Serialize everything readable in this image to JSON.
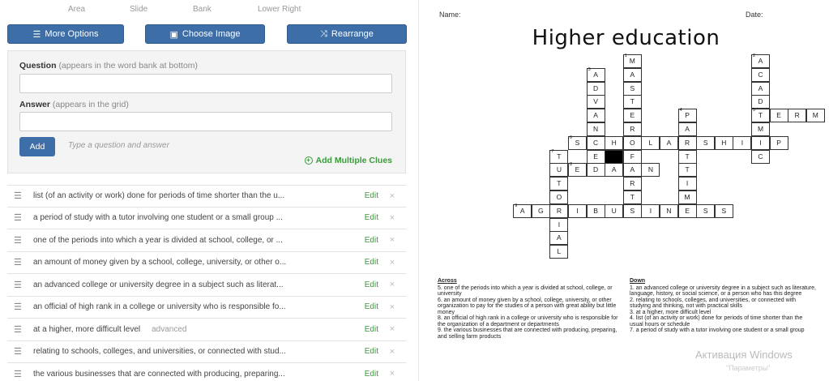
{
  "top_cut": [
    "Area",
    "Slide",
    "Bank",
    "Lower Right"
  ],
  "toolbar": {
    "more_options": "More Options",
    "choose_image": "Choose Image",
    "rearrange": "Rearrange"
  },
  "form": {
    "question_label": "Question",
    "question_hint": "(appears in the word bank at bottom)",
    "question_value": "",
    "answer_label": "Answer",
    "answer_hint": "(appears in the grid)",
    "answer_value": "",
    "add_label": "Add",
    "add_hint": "Type a question and answer",
    "add_multiple": "Add Multiple Clues"
  },
  "clues": [
    {
      "text": "list (of an activity or work) done for periods of time shorter than the u...",
      "answer": ""
    },
    {
      "text": "a period of study with a tutor involving one student or a small group ...",
      "answer": ""
    },
    {
      "text": "one of the periods into which a year is divided at school, college, or ...",
      "answer": ""
    },
    {
      "text": "an amount of money given by a school, college, university, or other o...",
      "answer": ""
    },
    {
      "text": "an advanced college or university degree in a subject such as literat...",
      "answer": ""
    },
    {
      "text": "an official of high rank in a college or university who is responsible fo...",
      "answer": ""
    },
    {
      "text": "at a higher, more difficult level",
      "answer": "advanced"
    },
    {
      "text": "relating to schools, colleges, and universities, or connected with stud...",
      "answer": ""
    },
    {
      "text": "the various businesses that are connected with producing, preparing...",
      "answer": ""
    }
  ],
  "clue_edit": "Edit",
  "clue_delete": "×",
  "puzzle": {
    "name_label": "Name:",
    "date_label": "Date:",
    "title": "Higher education",
    "across_heading": "Across",
    "down_heading": "Down",
    "across": [
      "5. one of the periods into which a year is divided at school, college, or university",
      "6. an amount of money given by a school, college, university, or other organization to pay for the studies of a person with great ability but little money",
      "8. an official of high rank in a college or university who is responsible for the organization of a department or departments",
      "9. the various businesses that are connected with producing, preparing, and selling farm products"
    ],
    "down": [
      "1. an advanced college or university degree in a subject such as literature, language, history, or social science, or a person who has this degree",
      "2. relating to schools, colleges, and universities, or connected with studying and thinking, not with practical skills",
      "3. at a higher, more difficult level",
      "4. list (of an activity or work) done for periods of time shorter than the usual hours or schedule",
      "7. a period of study with a tutor involving one student or a small group"
    ],
    "watermark": "Активация Windows",
    "watermark2": "\"Параметры\""
  },
  "grid_cells": [
    {
      "c": 8,
      "r": 0,
      "l": "M",
      "n": "1"
    },
    {
      "c": 8,
      "r": 1,
      "l": "A"
    },
    {
      "c": 8,
      "r": 2,
      "l": "S"
    },
    {
      "c": 8,
      "r": 3,
      "l": "T"
    },
    {
      "c": 8,
      "r": 4,
      "l": "E"
    },
    {
      "c": 8,
      "r": 5,
      "l": "R"
    },
    {
      "c": 8,
      "r": 6,
      "l": "O"
    },
    {
      "c": 8,
      "r": 7,
      "l": "F"
    },
    {
      "c": 8,
      "r": 8,
      "l": "A"
    },
    {
      "c": 8,
      "r": 9,
      "l": "R"
    },
    {
      "c": 8,
      "r": 10,
      "l": "T"
    },
    {
      "c": 8,
      "r": 11,
      "l": "S"
    },
    {
      "c": 15,
      "r": 0,
      "l": "A",
      "n": "2"
    },
    {
      "c": 15,
      "r": 1,
      "l": "C"
    },
    {
      "c": 15,
      "r": 2,
      "l": "A"
    },
    {
      "c": 15,
      "r": 3,
      "l": "D"
    },
    {
      "c": 15,
      "r": 4,
      "l": "E"
    },
    {
      "c": 15,
      "r": 5,
      "l": "M"
    },
    {
      "c": 15,
      "r": 6,
      "l": "I"
    },
    {
      "c": 15,
      "r": 7,
      "l": "C"
    },
    {
      "c": 6,
      "r": 1,
      "l": "A",
      "n": "3"
    },
    {
      "c": 6,
      "r": 2,
      "l": "D"
    },
    {
      "c": 6,
      "r": 3,
      "l": "V"
    },
    {
      "c": 6,
      "r": 4,
      "l": "A"
    },
    {
      "c": 6,
      "r": 5,
      "l": "N"
    },
    {
      "c": 6,
      "r": 6,
      "l": "C"
    },
    {
      "c": 6,
      "r": 7,
      "l": "E"
    },
    {
      "c": 6,
      "r": 8,
      "l": "D"
    },
    {
      "c": 11,
      "r": 4,
      "l": "P",
      "n": "4"
    },
    {
      "c": 11,
      "r": 5,
      "l": "A"
    },
    {
      "c": 11,
      "r": 6,
      "l": "R"
    },
    {
      "c": 11,
      "r": 7,
      "l": "T"
    },
    {
      "c": 11,
      "r": 8,
      "l": "T"
    },
    {
      "c": 11,
      "r": 9,
      "l": "I"
    },
    {
      "c": 11,
      "r": 10,
      "l": "M"
    },
    {
      "c": 11,
      "r": 11,
      "l": "E"
    },
    {
      "c": 15,
      "r": 4,
      "l": "T",
      "n": "5"
    },
    {
      "c": 16,
      "r": 4,
      "l": "E"
    },
    {
      "c": 17,
      "r": 4,
      "l": "R"
    },
    {
      "c": 18,
      "r": 4,
      "l": "M"
    },
    {
      "c": 5,
      "r": 6,
      "l": "S",
      "n": "6"
    },
    {
      "c": 7,
      "r": 6,
      "l": "H"
    },
    {
      "c": 9,
      "r": 6,
      "l": "L"
    },
    {
      "c": 10,
      "r": 6,
      "l": "A"
    },
    {
      "c": 12,
      "r": 6,
      "l": "S"
    },
    {
      "c": 13,
      "r": 6,
      "l": "H"
    },
    {
      "c": 14,
      "r": 6,
      "l": "I"
    },
    {
      "c": 16,
      "r": 6,
      "l": "P"
    },
    {
      "c": 4,
      "r": 7,
      "l": "T",
      "n": "7"
    },
    {
      "c": 4,
      "r": 8,
      "l": "U"
    },
    {
      "c": 4,
      "r": 9,
      "l": "T"
    },
    {
      "c": 4,
      "r": 10,
      "l": "O"
    },
    {
      "c": 4,
      "r": 11,
      "l": "R"
    },
    {
      "c": 4,
      "r": 12,
      "l": "I"
    },
    {
      "c": 4,
      "r": 13,
      "l": "A"
    },
    {
      "c": 4,
      "r": 14,
      "l": "L"
    },
    {
      "c": 7,
      "r": 7,
      "l": "",
      "black": true
    },
    {
      "c": 5,
      "r": 8,
      "l": "E",
      "n": "8"
    },
    {
      "c": 7,
      "r": 8,
      "l": "A"
    },
    {
      "c": 9,
      "r": 8,
      "l": "N"
    },
    {
      "c": 2,
      "r": 11,
      "l": "A",
      "n": "9"
    },
    {
      "c": 3,
      "r": 11,
      "l": "G"
    },
    {
      "c": 5,
      "r": 11,
      "l": "I"
    },
    {
      "c": 6,
      "r": 11,
      "l": "B"
    },
    {
      "c": 7,
      "r": 11,
      "l": "U"
    },
    {
      "c": 9,
      "r": 11,
      "l": "I"
    },
    {
      "c": 10,
      "r": 11,
      "l": "N"
    },
    {
      "c": 12,
      "r": 11,
      "l": "S"
    },
    {
      "c": 13,
      "r": 11,
      "l": "S"
    }
  ]
}
